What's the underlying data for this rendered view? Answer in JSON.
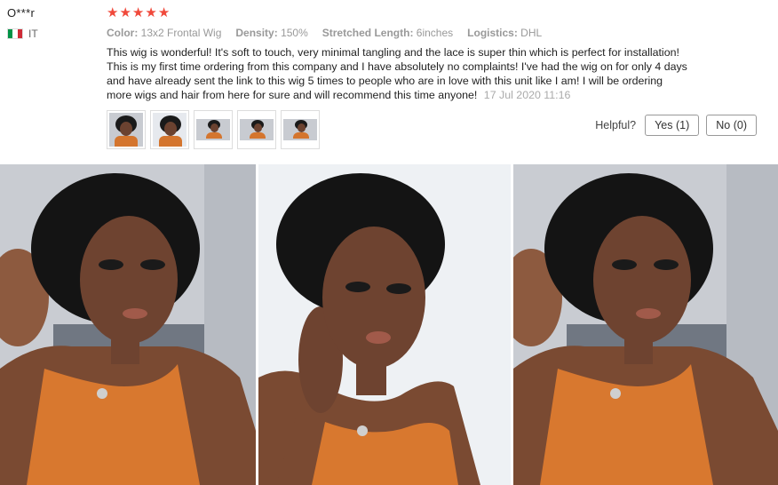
{
  "review": {
    "user": "O***r",
    "country_code": "IT",
    "flag_colors": [
      "#009246",
      "#ffffff",
      "#ce2b37"
    ],
    "rating": 5,
    "star_color": "#f0493b",
    "attributes": [
      {
        "key": "Color:",
        "value": "13x2 Frontal Wig"
      },
      {
        "key": "Density:",
        "value": "150%"
      },
      {
        "key": "Stretched Length:",
        "value": "6inches"
      },
      {
        "key": "Logistics:",
        "value": "DHL"
      }
    ],
    "text": "This wig is wonderful! It's soft to touch, very minimal tangling and the lace is super thin which is perfect for installation! This is my first time ordering from this company and I have absolutely no complaints! I've had the wig on for only 4 days and have already sent the link to this wig 5 times to people who are in love with this unit like I am! I will be ordering more wigs and hair from here for sure and will recommend this time anyone!",
    "date": "17 Jul 2020 11:16",
    "thumbnail_count": 5,
    "helpful": {
      "label": "Helpful?",
      "yes": "Yes (1)",
      "no": "No (0)"
    }
  },
  "gallery": {
    "photo_count": 3
  }
}
